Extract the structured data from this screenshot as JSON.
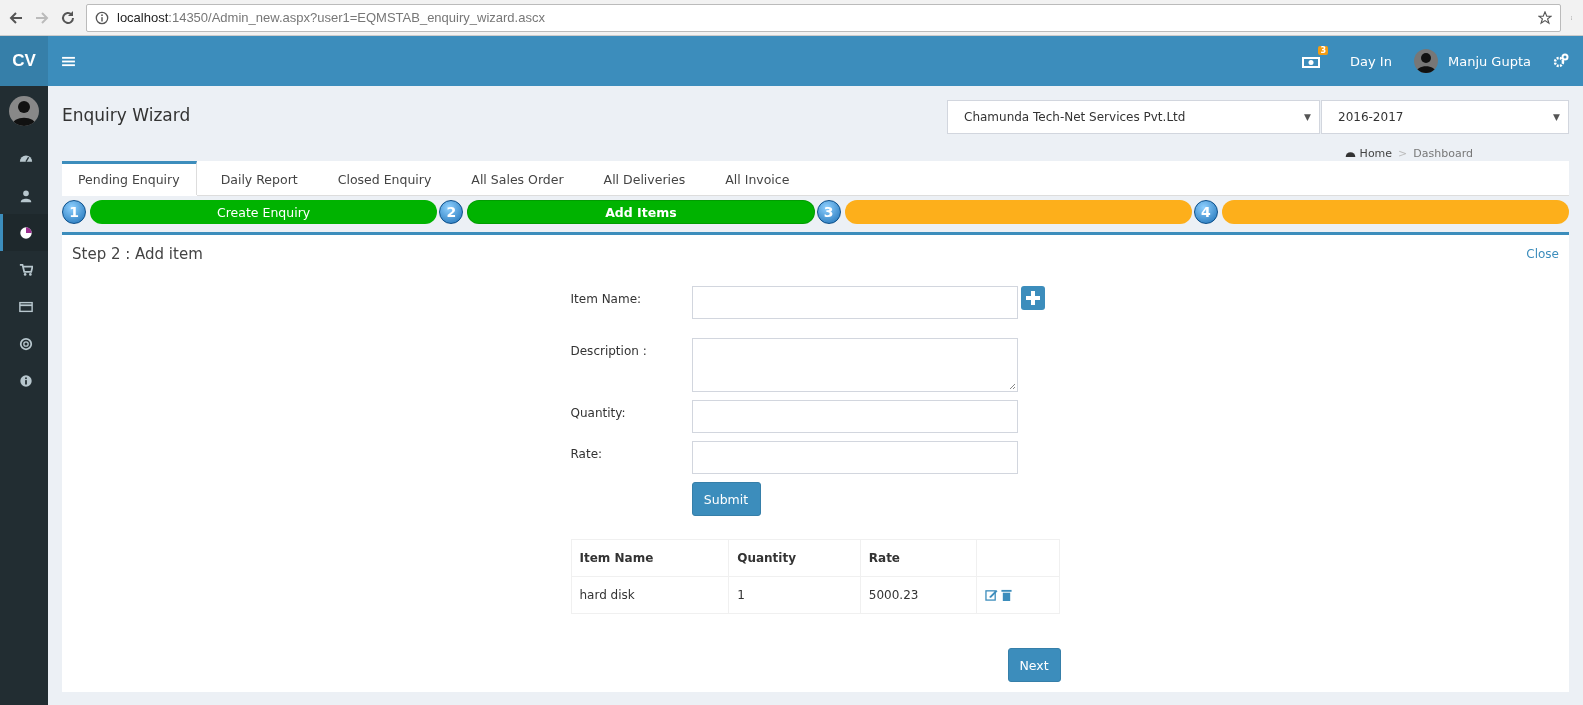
{
  "browser": {
    "url_host": "localhost",
    "url_path": ":14350/Admin_new.aspx?user1=EQMSTAB_enquiry_wizard.ascx"
  },
  "header": {
    "logo": "CV",
    "notification_count": "3",
    "day_in": "Day In",
    "user_name": "Manju Gupta"
  },
  "sidebar": {
    "items": [
      {
        "selected": false
      },
      {
        "selected": false
      },
      {
        "selected": true
      },
      {
        "selected": false
      },
      {
        "selected": false
      },
      {
        "selected": false
      },
      {
        "selected": false
      }
    ]
  },
  "page": {
    "title": "Enquiry Wizard",
    "company_select": "Chamunda Tech-Net Services Pvt.Ltd",
    "company_caret": "▼",
    "year_select": "2016-2017",
    "year_caret": "▼",
    "breadcrumb": [
      "Home",
      "Dashboard"
    ],
    "breadcrumb_separator": ">"
  },
  "tabs": [
    {
      "label": "Pending Enquiry",
      "selected": true
    },
    {
      "label": "Daily Report",
      "selected": false
    },
    {
      "label": "Closed Enquiry",
      "selected": false
    },
    {
      "label": "All Sales Order",
      "selected": false
    },
    {
      "label": "All Deliveries",
      "selected": false
    },
    {
      "label": "All Invoice",
      "selected": false
    }
  ],
  "steps": [
    {
      "number": "1",
      "label": "Create Enquiry",
      "complete": true,
      "selected": false
    },
    {
      "number": "2",
      "label": "Add Items",
      "complete": true,
      "selected": true
    },
    {
      "number": "3",
      "complete": false,
      "selected": false
    },
    {
      "number": "4",
      "complete": false,
      "selected": false
    }
  ],
  "panel": {
    "title": "Step 2 : Add item",
    "close": "Close",
    "fields": [
      {
        "label": "Item Name:",
        "kind": "input",
        "add_button": true
      },
      {
        "label": "Description :",
        "kind": "textarea",
        "add_button": false
      },
      {
        "label": "Quantity:",
        "kind": "input",
        "add_button": false
      },
      {
        "label": "Rate:",
        "kind": "input",
        "add_button": false
      }
    ],
    "submit": "Submit",
    "table": {
      "columns": [
        "Item Name",
        "Quantity",
        "Rate"
      ],
      "rows": [
        {
          "cells": [
            "hard disk",
            "1",
            "5000.23"
          ]
        }
      ]
    },
    "next": "Next"
  }
}
